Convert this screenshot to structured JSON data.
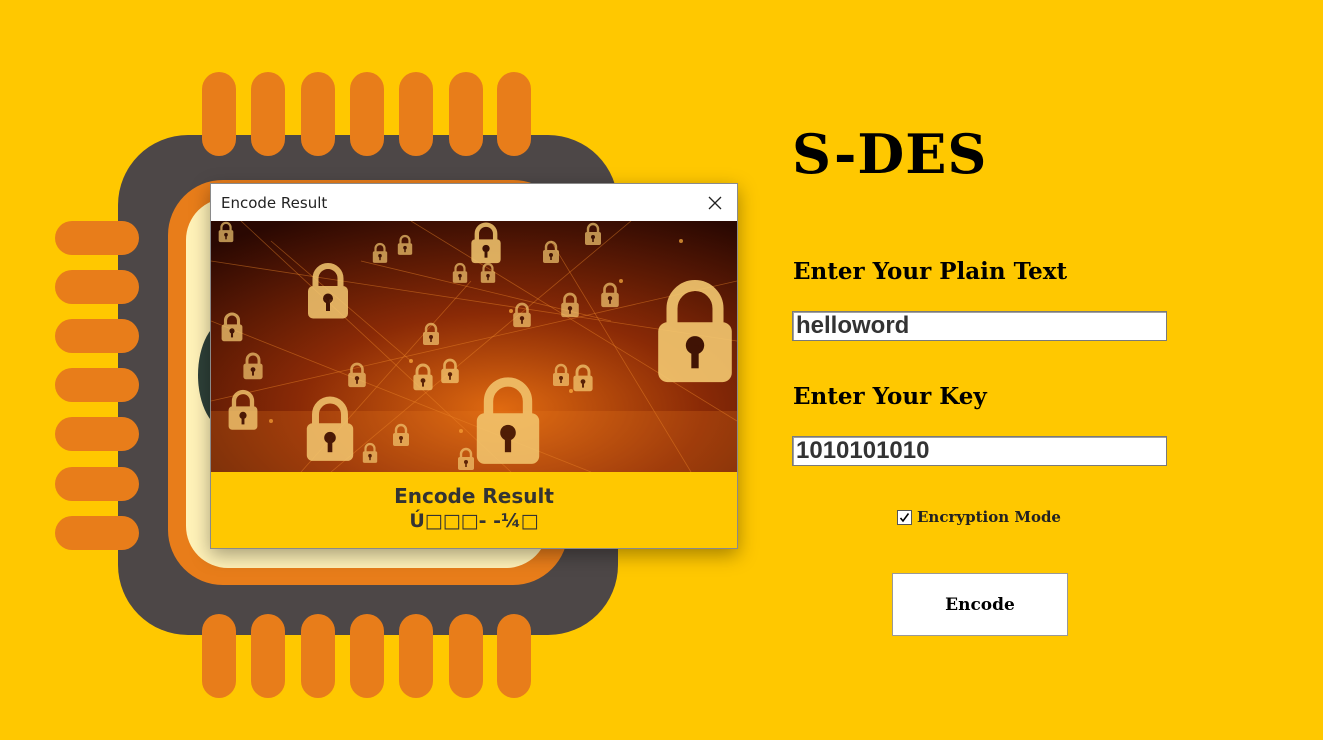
{
  "app": {
    "title": "S-DES"
  },
  "form": {
    "plain_label": "Enter Your Plain Text",
    "plain_value": "helloword",
    "key_label": "Enter Your Key",
    "key_value": "1010101010",
    "mode_label": "Encryption Mode",
    "mode_checked": true,
    "encode_label": "Encode"
  },
  "dialog": {
    "title": "Encode Result",
    "heading": "Encode Result",
    "result": "Ú□□□- -¼□"
  },
  "colors": {
    "background": "#FFC800",
    "chip_orange": "#E87D1A",
    "chip_dark": "#4D4747",
    "chip_core": "#FFF2B8"
  },
  "icons": {
    "close": "close-icon",
    "check": "check-icon",
    "lock": "padlock-icon"
  }
}
